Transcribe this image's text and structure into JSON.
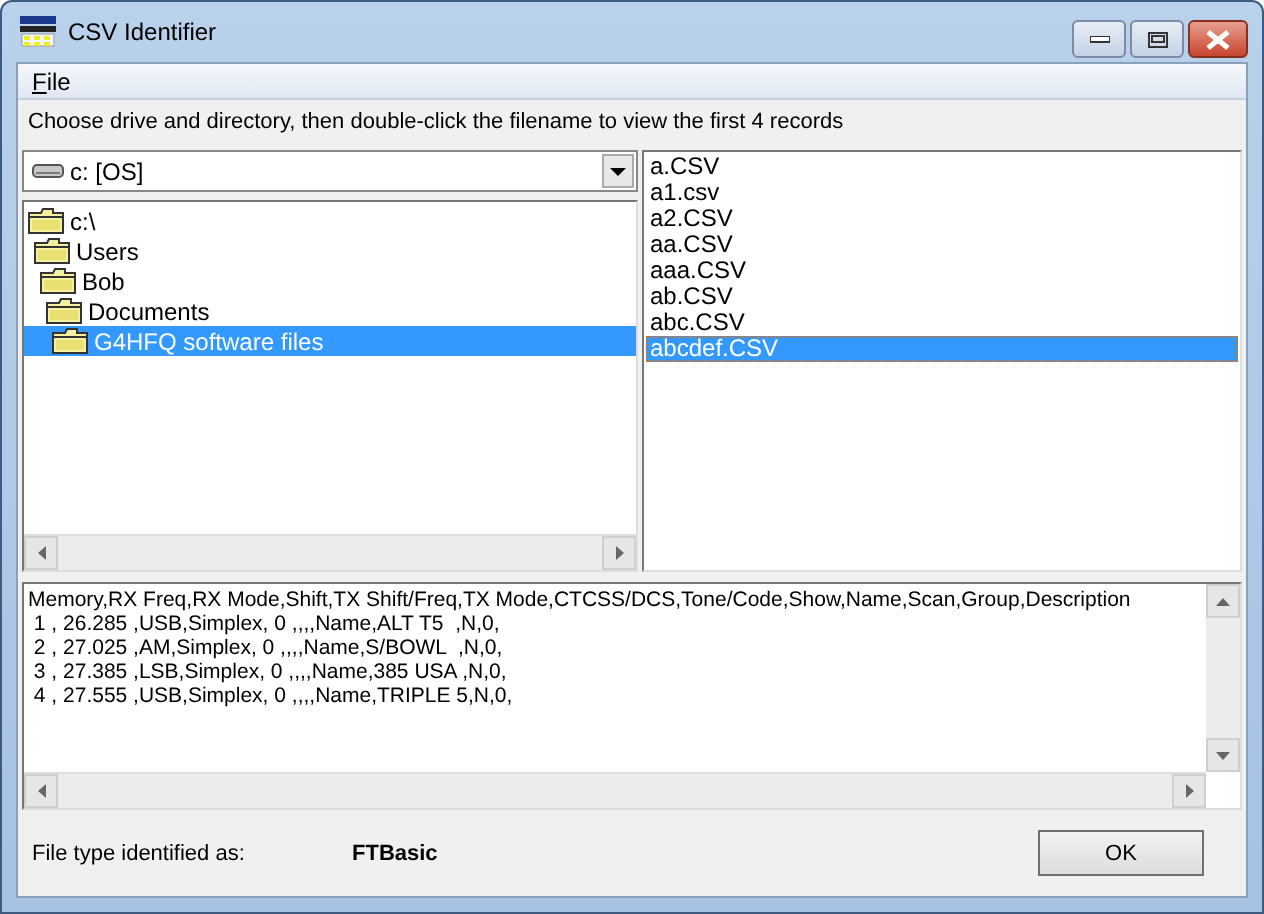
{
  "window": {
    "title": "CSV Identifier"
  },
  "menu": [
    {
      "label": "File"
    }
  ],
  "instruction": "Choose drive and directory, then double-click the filename to view the first 4 records",
  "drive": {
    "value": "c: [OS]"
  },
  "folders": [
    {
      "label": "c:\\",
      "selected": false,
      "children": [
        {
          "label": "Users",
          "selected": false,
          "children": [
            {
              "label": "Bob",
              "selected": false,
              "children": [
                {
                  "label": "Documents",
                  "selected": false,
                  "children": [
                    {
                      "label": "G4HFQ software files",
                      "selected": true
                    }
                  ]
                }
              ]
            }
          ]
        }
      ]
    }
  ],
  "files": [
    {
      "name": "a.CSV",
      "selected": false
    },
    {
      "name": "a1.csv",
      "selected": false
    },
    {
      "name": "a2.CSV",
      "selected": false
    },
    {
      "name": "aa.CSV",
      "selected": false
    },
    {
      "name": "aaa.CSV",
      "selected": false
    },
    {
      "name": "ab.CSV",
      "selected": false
    },
    {
      "name": "abc.CSV",
      "selected": false
    },
    {
      "name": "abcdef.CSV",
      "selected": true
    }
  ],
  "records": [
    "Memory,RX Freq,RX Mode,Shift,TX Shift/Freq,TX Mode,CTCSS/DCS,Tone/Code,Show,Name,Scan,Group,Description",
    " 1 , 26.285 ,USB,Simplex, 0 ,,,,Name,ALT T5  ,N,0,",
    " 2 , 27.025 ,AM,Simplex, 0 ,,,,Name,S/BOWL  ,N,0,",
    " 3 , 27.385 ,LSB,Simplex, 0 ,,,,Name,385 USA ,N,0,",
    " 4 , 27.555 ,USB,Simplex, 0 ,,,,Name,TRIPLE 5,N,0,"
  ],
  "result": {
    "label": "File type identified as:",
    "value": "FTBasic"
  },
  "buttons": [
    "OK"
  ]
}
